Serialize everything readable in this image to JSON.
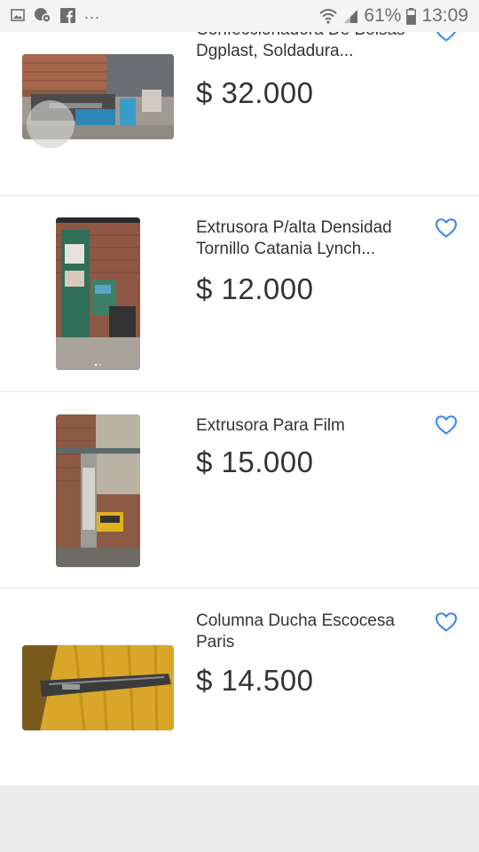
{
  "status_bar": {
    "overflow_dots": "...",
    "battery_percent": "61%",
    "time": "13:09",
    "icons": [
      "image-icon",
      "chat-settings-icon",
      "facebook-icon",
      "wifi-icon",
      "signal-icon",
      "battery-icon"
    ]
  },
  "listings": [
    {
      "title": "Confeccionadora De Bolsas Dgplast, Soldadura...",
      "price": "$ 32.000"
    },
    {
      "title": "Extrusora P/alta Densidad Tornillo Catania Lynch...",
      "price": "$ 12.000"
    },
    {
      "title": "Extrusora Para Film",
      "price": "$ 15.000"
    },
    {
      "title": "Columna Ducha Escocesa Paris",
      "price": "$ 14.500"
    }
  ],
  "colors": {
    "favorite_accent": "#3483fa",
    "text": "#333333",
    "divider": "#e3e3e3",
    "page_bg": "#ebebeb"
  }
}
